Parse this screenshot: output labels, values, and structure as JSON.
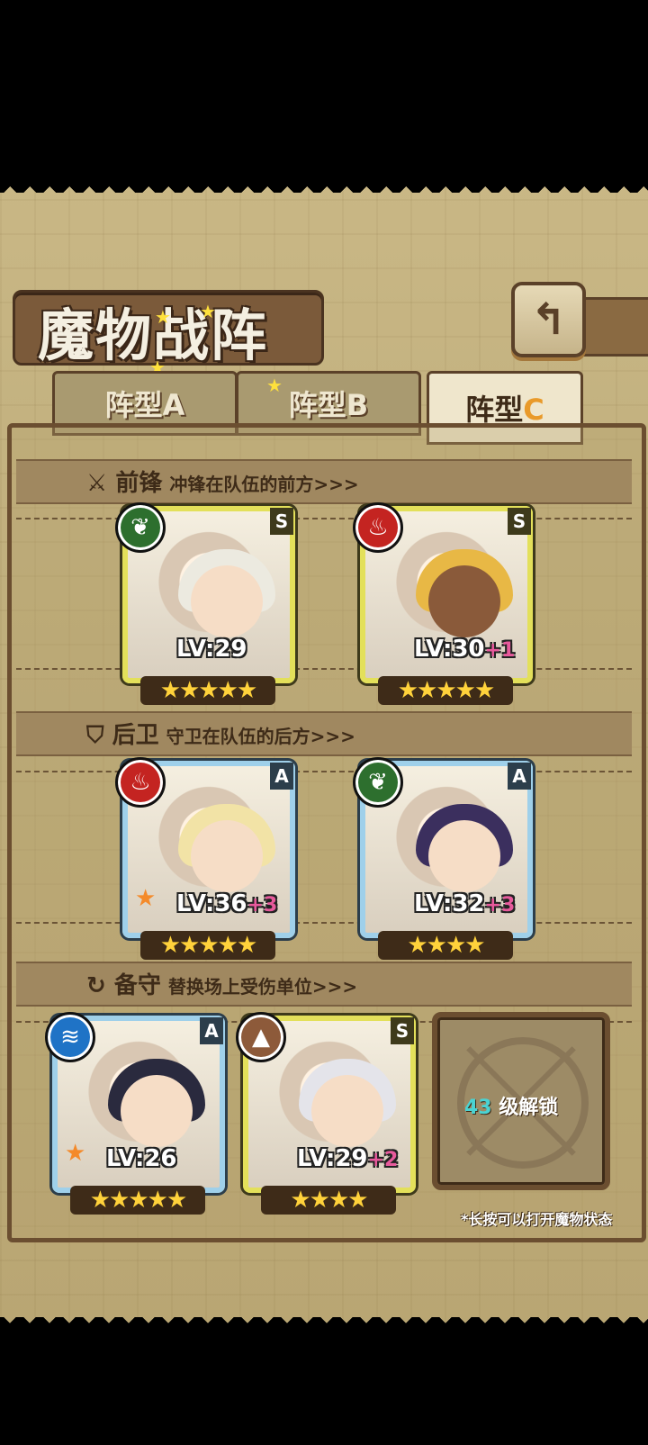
{
  "header": {
    "title": "魔物战阵",
    "back_icon": "return-icon"
  },
  "tabs": [
    {
      "label": "阵型A",
      "active": false
    },
    {
      "label": "阵型B",
      "active": false
    },
    {
      "label_main": "阵型",
      "label_accent": "C",
      "active": true
    }
  ],
  "sections": {
    "front": {
      "title": "前锋",
      "subtitle": "冲锋在队伍的前方>>>",
      "icon": "sword-icon"
    },
    "back": {
      "title": "后卫",
      "subtitle": "守卫在队伍的后方>>>",
      "icon": "shield-icon"
    },
    "reserve": {
      "title": "备守",
      "subtitle": "替换场上受伤单位>>>",
      "icon": "swap-icon"
    }
  },
  "cards": {
    "front1": {
      "element": "leaf-icon",
      "rank": "S",
      "level": "LV:29",
      "plus": "",
      "stars": "★★★★★"
    },
    "front2": {
      "element": "fire-icon",
      "rank": "S",
      "level": "LV:30",
      "plus": "+1",
      "stars": "★★★★★"
    },
    "back1": {
      "element": "fire-icon",
      "rank": "A",
      "level": "LV:36",
      "plus": "+3",
      "stars": "★★★★★"
    },
    "back2": {
      "element": "leaf-icon",
      "rank": "A",
      "level": "LV:32",
      "plus": "+3",
      "stars": "★★★★"
    },
    "res1": {
      "element": "water-icon",
      "rank": "A",
      "level": "LV:26",
      "plus": "",
      "stars": "★★★★★"
    },
    "res2": {
      "element": "earth-icon",
      "rank": "S",
      "level": "LV:29",
      "plus": "+2",
      "stars": "★★★★"
    }
  },
  "locked_slot": {
    "level": "43",
    "label": "级解锁"
  },
  "hint": "*长按可以打开魔物状态",
  "colors": {
    "gold_frame": "#e3e05a",
    "blue_frame": "#9fd0ea",
    "accent_c": "#e99a2a"
  }
}
